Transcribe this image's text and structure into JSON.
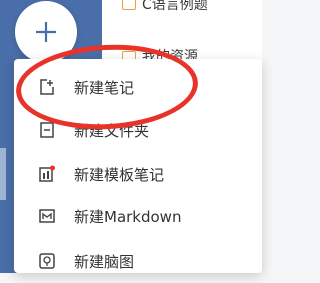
{
  "background_list": {
    "items": [
      {
        "label": "C语言例题"
      },
      {
        "label": "我的资源"
      }
    ]
  },
  "new_button": {
    "icon": "plus-icon"
  },
  "menu": {
    "items": [
      {
        "label": "新建笔记",
        "icon": "new-note-icon"
      },
      {
        "label": "新建文件夹",
        "icon": "new-folder-icon"
      },
      {
        "label": "新建模板笔记",
        "icon": "template-note-icon"
      },
      {
        "label": "新建Markdown",
        "icon": "markdown-icon"
      },
      {
        "label": "新建脑图",
        "icon": "mindmap-icon"
      }
    ]
  },
  "colors": {
    "sidebar": "#4a6ea9",
    "highlight_circle": "#e8332a",
    "template_dot": "#e8332a"
  }
}
